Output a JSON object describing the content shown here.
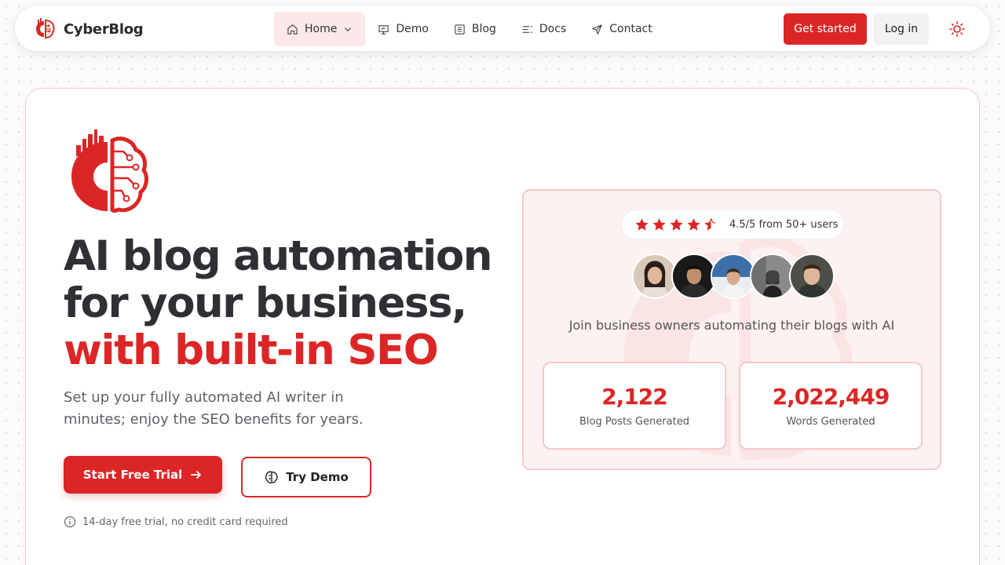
{
  "brand": {
    "name": "CyberBlog"
  },
  "nav": {
    "items": [
      {
        "label": "Home",
        "icon": "home-icon",
        "active": true,
        "has_dropdown": true
      },
      {
        "label": "Demo",
        "icon": "presentation-icon"
      },
      {
        "label": "Blog",
        "icon": "article-icon"
      },
      {
        "label": "Docs",
        "icon": "list-icon"
      },
      {
        "label": "Contact",
        "icon": "send-icon"
      }
    ],
    "get_started": "Get started",
    "login": "Log in",
    "theme_icon": "sun-icon"
  },
  "hero": {
    "headline_line1": "AI blog automation",
    "headline_line2": "for your business,",
    "headline_accent": "with built-in SEO",
    "subtext": "Set up your fully automated AI writer in minutes; enjoy the SEO benefits for years.",
    "cta_primary": "Start Free Trial",
    "cta_secondary": "Try Demo",
    "note": "14-day free trial, no credit card required"
  },
  "social_proof": {
    "rating_stars": 4.5,
    "rating_text": "4.5/5 from 50+ users",
    "join_text": "Join business owners automating their blogs with AI",
    "stats": [
      {
        "value": "2,122",
        "label": "Blog Posts Generated"
      },
      {
        "value": "2,022,449",
        "label": "Words Generated"
      }
    ]
  },
  "colors": {
    "accent": "#dc2626",
    "accent_light": "#fbe8e8",
    "text_dark": "#2f3036"
  }
}
